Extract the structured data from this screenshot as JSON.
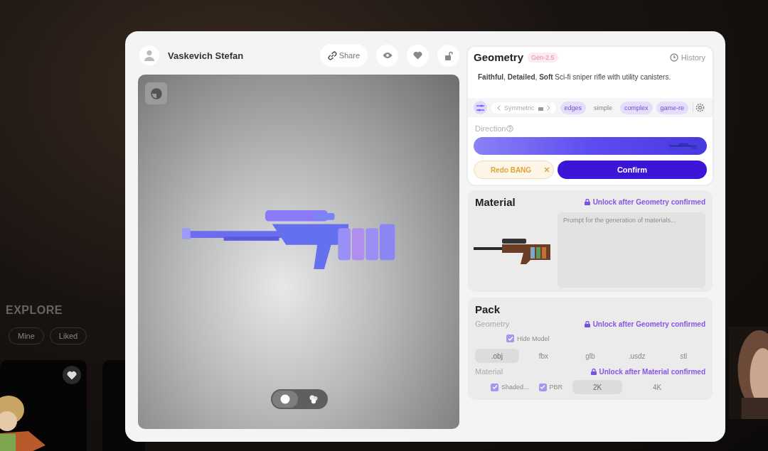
{
  "background": {
    "heading": "EXPLORE",
    "filters": [
      {
        "label": "Mine",
        "selected": false
      },
      {
        "label": "Liked",
        "selected": false
      }
    ]
  },
  "author": {
    "name": "Vaskevich Stefan"
  },
  "toolbar": {
    "share": "Share"
  },
  "viewer": {
    "modes": [
      {
        "kind": "light",
        "selected": true
      },
      {
        "kind": "material",
        "selected": false
      }
    ]
  },
  "geometry": {
    "title": "Geometry",
    "badge": "Gen-2.5",
    "history": "History",
    "prompt": "**Faithful**, **Detailed**, **Soft** Sci-fi sniper rifle with utility canisters.",
    "symmetry": "Symmetric",
    "tags": [
      {
        "label": "edges",
        "selected": true
      },
      {
        "label": "simple",
        "selected": false
      },
      {
        "label": "complex",
        "selected": true
      },
      {
        "label": "game-re",
        "selected": true
      }
    ],
    "direction_label": "Direction",
    "redo": "Redo BANG",
    "confirm": "Confirm"
  },
  "material": {
    "title": "Material",
    "lock": "Unlock after Geometry confirmed",
    "placeholder": "Prompt for the generation of materials..."
  },
  "pack": {
    "title": "Pack",
    "geometry_label": "Geometry",
    "geometry_lock": "Unlock after Geometry confirmed",
    "geometry_options": [
      {
        "label": "Hide Model",
        "checked": true
      }
    ],
    "formats": [
      {
        "label": ".obj",
        "selected": true
      },
      {
        "label": "fbx",
        "selected": false
      },
      {
        "label": "glb",
        "selected": false
      },
      {
        "label": ".usdz",
        "selected": false
      },
      {
        "label": "stl",
        "selected": false
      }
    ],
    "material_label": "Material",
    "material_lock": "Unlock after Material confirmed",
    "material_options": [
      {
        "label": "Shaded...",
        "checked": true
      },
      {
        "label": "PBR",
        "checked": true
      }
    ],
    "resolutions": [
      {
        "label": "2K",
        "selected": true
      },
      {
        "label": "4K",
        "selected": false
      }
    ]
  }
}
